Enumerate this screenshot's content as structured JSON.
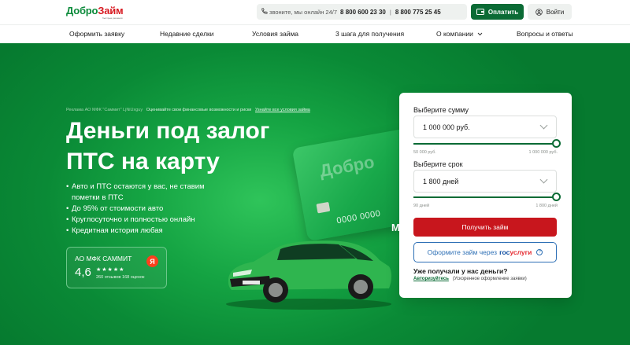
{
  "header": {
    "logo": {
      "brand_main": "Добро",
      "brand_accent": "Займ",
      "tagline": "быстрые решения"
    },
    "phone_bar": {
      "note": "звоните, мы онлайн 24/7",
      "phone_1": "8 800 600 23 30",
      "separator": "|",
      "phone_2": "8 800 775 25 45"
    },
    "pay_label": "Оплатить",
    "login_label": "Войти"
  },
  "nav": {
    "items": [
      "Оформить заявку",
      "Недавние сделки",
      "Условия займа",
      "3 шага для получения",
      "О компании",
      "Вопросы и ответы"
    ]
  },
  "hero": {
    "ad_note": "Реклама АО МФК \"Саммит\" LjNiUxguy",
    "assess_note": "Оценивайте свои финансовые возможности и риски",
    "conditions_link": "Узнайте все условия займа",
    "title_line_1": "Деньги под залог",
    "title_line_2": "ПТС на карту",
    "bullets": [
      "Авто и ПТС остаются у вас, не ставим",
      "пометки в ПТС",
      "До 95% от стоимости авто",
      "Круглосуточно и полностью онлайн",
      "Кредитная история любая"
    ],
    "rating": {
      "org": "АО МФК САММИТ",
      "score": "4,6",
      "stars": "★★★★★",
      "reviews": "260 отзывов 168 оценок",
      "badge": "Я"
    },
    "card": {
      "brand": "Добро",
      "number": "0000 0000",
      "mark": "M"
    }
  },
  "form": {
    "sum_label": "Выберите сумму",
    "sum_value": "1 000 000 руб.",
    "sum_min": "50 000 руб.",
    "sum_max": "1 000 000 руб.",
    "sum_fraction": 1.0,
    "term_label": "Выберите срок",
    "term_value": "1 800 дней",
    "term_min": "90 дней",
    "term_max": "1 800 дней",
    "term_fraction": 1.0,
    "submit_label": "Получить займ",
    "gosuslugi_prefix": "Оформите займ через",
    "gosuslugi_gos": "гос",
    "gosuslugi_uslugi": "услуги",
    "already_label": "Уже получали у нас деньги?",
    "auth_link": "Авторизуйтесь",
    "auth_note": "(Ускоренное оформление заявки)"
  },
  "colors": {
    "brand_green": "#0b6b35",
    "hero_green": "#15a443",
    "cta_red": "#c8161d",
    "gosuslugi_blue": "#2d6fb5"
  }
}
